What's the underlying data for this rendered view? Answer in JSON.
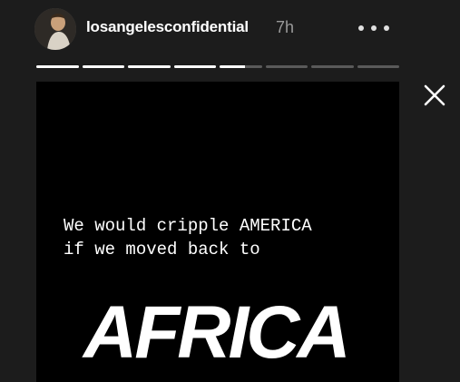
{
  "header": {
    "username": "losangelesconfidential",
    "time": "7h",
    "avatar_icon": "profile-photo"
  },
  "progress": {
    "segments": [
      1,
      1,
      1,
      1,
      0.6,
      0,
      0,
      0
    ]
  },
  "story": {
    "text": "We would cripple AMERICA\nif we moved back to",
    "big_text": "AFRICA"
  },
  "colors": {
    "background": "#1c1c1c",
    "story_background": "#000000",
    "progress_active": "#ffffff",
    "progress_inactive": "#5a5a5a"
  }
}
